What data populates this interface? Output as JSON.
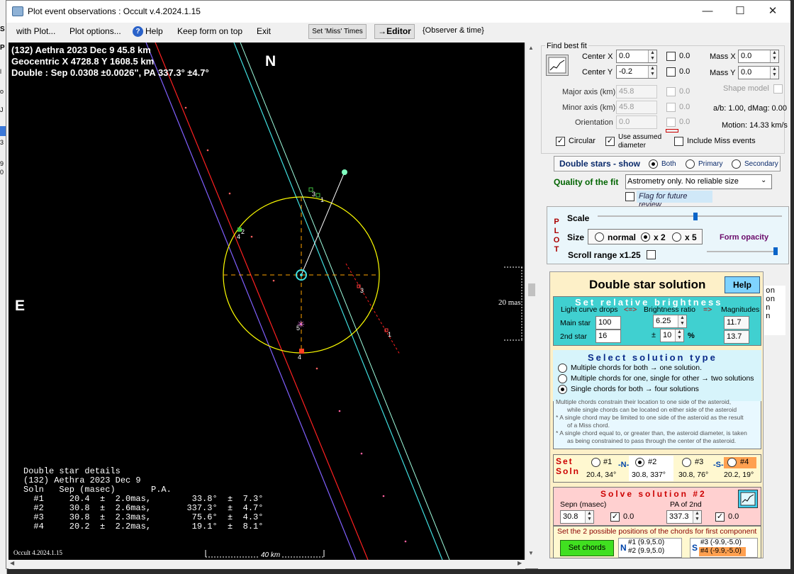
{
  "window": {
    "title": "Plot event observations : Occult v.4.2024.1.15",
    "minimize_glyph": "—",
    "maximize_glyph": "☐",
    "close_glyph": "✕"
  },
  "bg_strip_letters": [
    "S",
    "P",
    "l",
    "o",
    "o",
    "J",
    "3",
    "9",
    "0"
  ],
  "menu": {
    "with_plot": "with Plot...",
    "plot_options": "Plot options...",
    "help": "Help",
    "help_icon": "?",
    "keep_on_top": "Keep form on top",
    "exit": "Exit",
    "set_miss_times": "Set 'Miss' Times",
    "editor": "→Editor",
    "observer_time": "{Observer & time}"
  },
  "plot": {
    "header_line1": "(132) Aethra  2023 Dec 9   45.8 km",
    "header_line2": "Geocentric  X  4728.8  Y  1608.5 km",
    "header_line3": "Double : Sep  0.0308 ±0.0026\", PA 337.3° ±4.7°",
    "north": "N",
    "east": "E",
    "scale_label": "20 mas",
    "km_label": "40 km",
    "version_label": "Occult 4.2024.1.15",
    "chord_labels": [
      "3",
      "1",
      "2",
      "4",
      "3",
      "1",
      "5",
      "4"
    ],
    "details_title": "Double star details",
    "details_event": "(132) Aethra 2023 Dec 9",
    "details_header": "Soln   Sep (masec)       P.A.",
    "details_rows": [
      "  #1     20.4  ±  2.0mas,        33.8°  ±  7.3°",
      "  #2     30.8  ±  2.6mas,       337.3°  ±  4.7°",
      "  #3     30.8  ±  2.3mas,        75.6°  ±  4.3°",
      "  #4     20.2  ±  2.2mas,        19.1°  ±  8.1°"
    ]
  },
  "fit": {
    "group_title": "Find best fit",
    "center_x_label": "Center X",
    "center_x": "0.0",
    "center_y_label": "Center Y",
    "center_y": "-0.2",
    "cx_chk_val": "0.0",
    "cy_chk_val": "0.0",
    "mass_x_label": "Mass X",
    "mass_x": "0.0",
    "mass_y_label": "Mass Y",
    "mass_y": "0.0",
    "major_label": "Major axis (km)",
    "major": "45.8",
    "minor_label": "Minor axis (km)",
    "minor": "45.8",
    "orient_label": "Orientation",
    "orient": "0.0",
    "major_chk_val": "0.0",
    "minor_chk_val": "0.0",
    "orient_chk_val": "0.0",
    "shape_model": "Shape model",
    "ab_dmag": "a/b: 1.00, dMag: 0.00",
    "motion": "Motion: 14.33 km/s",
    "circular": "Circular",
    "use_assumed": "Use assumed",
    "diameter": "diameter",
    "include_miss": "Include Miss events",
    "tick": "✓"
  },
  "double_show": {
    "label": "Double stars - show",
    "both": "Both",
    "primary": "Primary",
    "secondary": "Secondary"
  },
  "quality": {
    "label": "Quality of the fit",
    "value": "Astrometry only. No reliable size",
    "flag": "Flag for future review"
  },
  "plotctl": {
    "side_letters": [
      "P",
      "L",
      "O",
      "T"
    ],
    "scale": "Scale",
    "size": "Size",
    "normal": "normal",
    "x2": "x 2",
    "x5": "x 5",
    "form_opacity": "Form opacity",
    "scroll_range": "Scroll range x1.25",
    "scale_pos": 0.53,
    "opacity_pos": 0.98
  },
  "solution": {
    "title": "Double star solution",
    "help": "Help",
    "bright_title": "Set relative brightness",
    "lc_drops": "Light curve drops",
    "bright_ratio": "Brightness ratio",
    "magnitudes": "Magnitudes",
    "arrow_left": "<=>",
    "arrow_right": "=>",
    "main_star": "Main star",
    "main_drop": "100",
    "ratio": "6.25",
    "main_mag": "11.7",
    "second_star": "2nd star",
    "second_drop": "16",
    "pm": "±",
    "ratio_err": "10",
    "pct": "%",
    "second_mag": "13.7",
    "type_title": "Select solution type",
    "type1": "Multiple chords for both → one solution.",
    "type2": "Multiple chords for one, single for other → two solutions",
    "type3": "Single chords for both → four solutions",
    "note1": "Multiple chords constrain their location to one side of the asteroid,",
    "note2": "while single chords can be located on either side of the asteroid",
    "note3": "* A single chord may be limited to one side of the asteroid as the result",
    "note4": "of a Miss chord.",
    "note5": "* A single chord equal to, or greater than, the asteroid diameter, is taken",
    "note6": "as being constrained to pass through the center of the asteroid.",
    "set_soln": [
      "Set",
      "Soln"
    ],
    "n_label": "-N-",
    "s_label": "-S-",
    "s1": "#1",
    "s1v": "20.4, 34°",
    "s2": "#2",
    "s2v": "30.8, 337°",
    "s3": "#3",
    "s3v": "30.8, 76°",
    "s4": "#4",
    "s4v": "20.2, 19°",
    "solve_title": "Solve solution #2",
    "sepn_label": "Sepn (masec)",
    "sepn": "30.8",
    "sepn_chk": "0.0",
    "pa_label": "PA of 2nd",
    "pa": "337.3",
    "pa_chk": "0.0",
    "chord_note": "Set the 2 possible positions of the chords for first component",
    "set_chords": "Set chords",
    "n_letter": "N",
    "s_letter": "S",
    "n1": "#1 (9.9,5.0)",
    "n2": "#2 (9.9,5.0)",
    "sa": "#3 (-9.9,-5.0)",
    "sb": "#4 (-9.9,-5.0)"
  },
  "overflow_text": [
    "on",
    "on",
    "n",
    "n"
  ],
  "colors": {
    "plot_bg": "#000000",
    "ellipse": "#ffff00",
    "chord_red": "#ff2020",
    "chord_blue": "#8060ff",
    "chord_cyan": "#40e0e0",
    "chord_teal": "#a0ffe0",
    "brightness_panel": "#40d0d0",
    "solve_panel": "#ffd0d0",
    "soln_panel": "#fff8d0"
  }
}
